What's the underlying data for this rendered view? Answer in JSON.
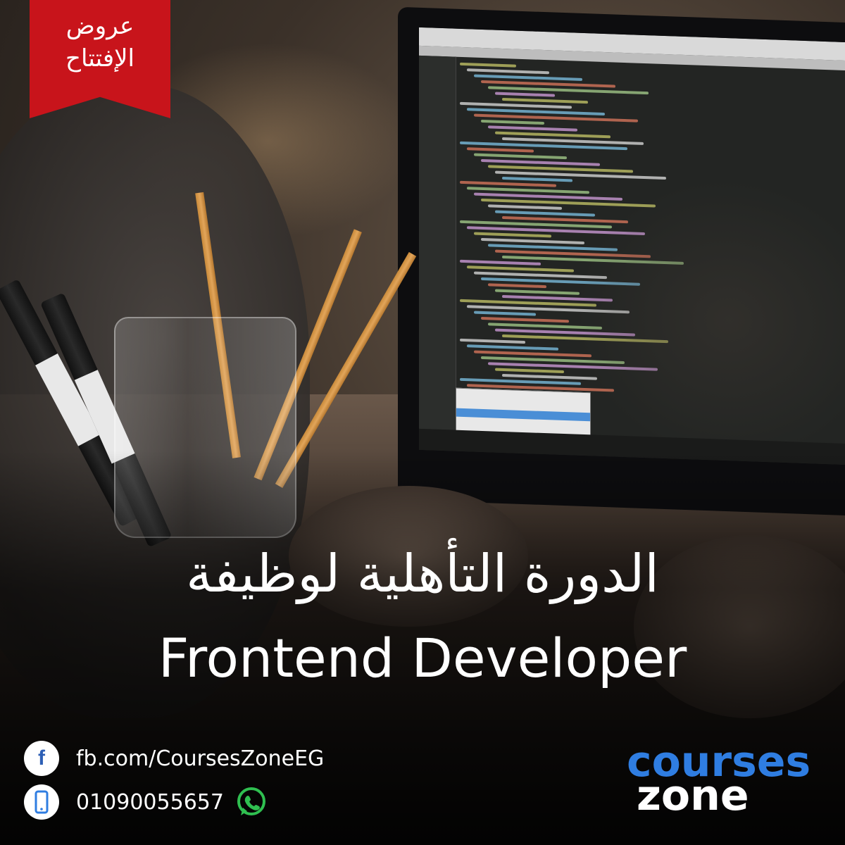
{
  "badge": {
    "line1": "عروض",
    "line2": "الإفتتاح",
    "color": "#c8141b"
  },
  "headline": {
    "arabic": "الدورة التأهلية لوظيفة",
    "english": "Frontend Developer"
  },
  "contacts": {
    "facebook": {
      "icon": "facebook-icon",
      "text": "fb.com/CoursesZoneEG"
    },
    "phone": {
      "icon": "mobile-phone-icon",
      "text": "01090055657",
      "extra_icon": "whatsapp-icon"
    }
  },
  "logo": {
    "line1": "courses",
    "line2": "zone",
    "colors": {
      "blue": "#2f7de1",
      "white": "#ffffff"
    }
  }
}
